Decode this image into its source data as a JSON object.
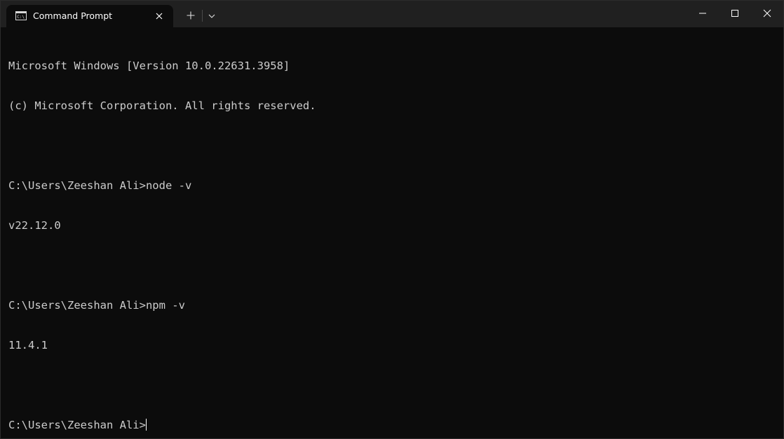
{
  "window": {
    "accent": "#0c0c0c",
    "titlebar_color": "#202020",
    "text_color": "#cccccc"
  },
  "tab": {
    "title": "Command Prompt",
    "icon": "command-prompt-icon"
  },
  "terminal": {
    "lines": [
      "Microsoft Windows [Version 10.0.22631.3958]",
      "(c) Microsoft Corporation. All rights reserved.",
      "",
      "C:\\Users\\Zeeshan Ali>node -v",
      "v22.12.0",
      "",
      "C:\\Users\\Zeeshan Ali>npm -v",
      "11.4.1",
      "",
      "C:\\Users\\Zeeshan Ali>"
    ]
  }
}
